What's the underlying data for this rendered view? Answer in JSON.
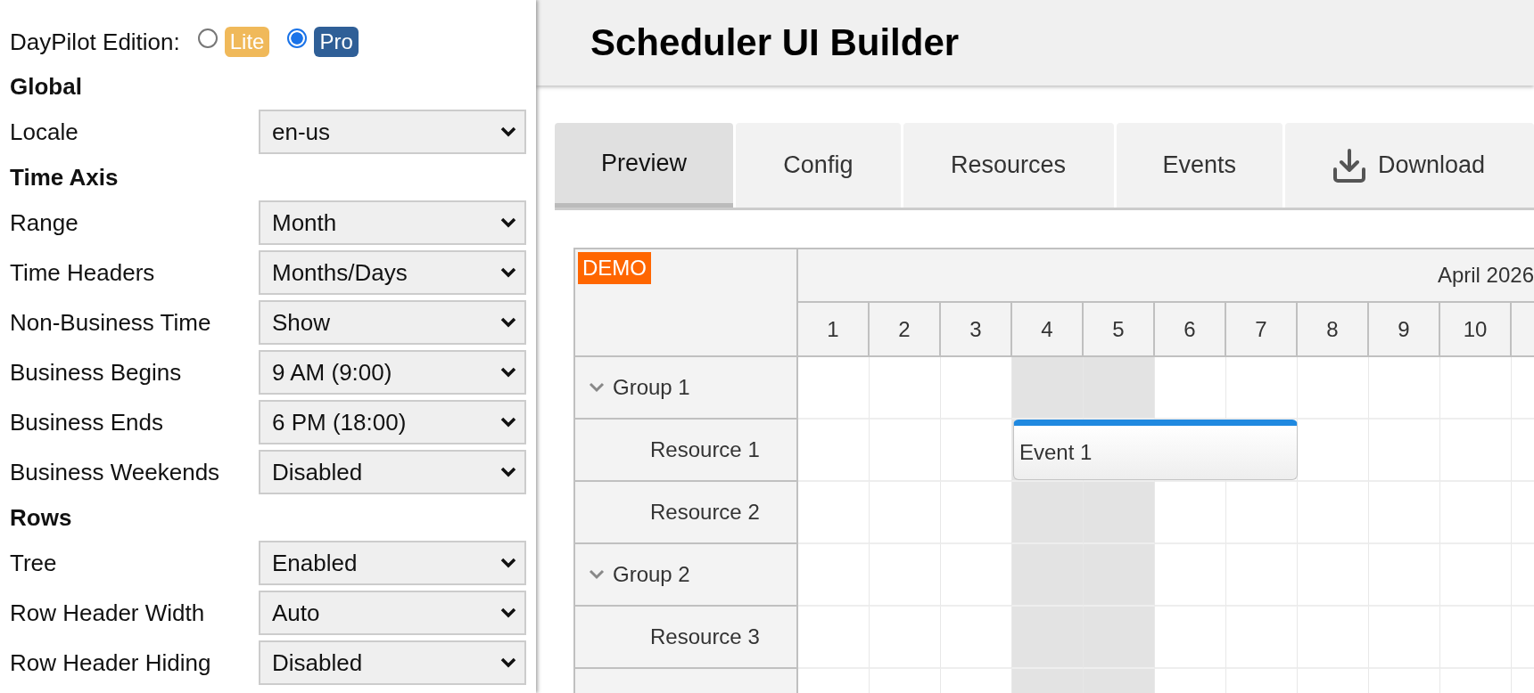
{
  "sidebar": {
    "edition": {
      "label": "DayPilot Edition:",
      "options": [
        {
          "label": "Lite",
          "selected": false,
          "color": "#f0b95a"
        },
        {
          "label": "Pro",
          "selected": true,
          "color": "#2f5f97"
        }
      ]
    },
    "sections": [
      {
        "title": "Global",
        "settings": [
          {
            "label": "Locale",
            "value": "en-us"
          }
        ]
      },
      {
        "title": "Time Axis",
        "settings": [
          {
            "label": "Range",
            "value": "Month"
          },
          {
            "label": "Time Headers",
            "value": "Months/Days"
          },
          {
            "label": "Non-Business Time",
            "value": "Show"
          },
          {
            "label": "Business Begins",
            "value": "9 AM (9:00)"
          },
          {
            "label": "Business Ends",
            "value": "6 PM (18:00)"
          },
          {
            "label": "Business Weekends",
            "value": "Disabled"
          }
        ]
      },
      {
        "title": "Rows",
        "settings": [
          {
            "label": "Tree",
            "value": "Enabled"
          },
          {
            "label": "Row Header Width",
            "value": "Auto"
          },
          {
            "label": "Row Header Hiding",
            "value": "Disabled"
          }
        ]
      }
    ]
  },
  "header": {
    "title": "Scheduler UI Builder"
  },
  "tabs": [
    {
      "label": "Preview",
      "selected": true,
      "kind": "text"
    },
    {
      "label": "Config",
      "selected": false,
      "kind": "text"
    },
    {
      "label": "Resources",
      "selected": false,
      "kind": "text"
    },
    {
      "label": "Events",
      "selected": false,
      "kind": "text"
    },
    {
      "label": "Download",
      "selected": false,
      "kind": "download"
    }
  ],
  "scheduler": {
    "badge": "DEMO",
    "month": "April 2026",
    "days": [
      {
        "label": "1",
        "weekend": false
      },
      {
        "label": "2",
        "weekend": false
      },
      {
        "label": "3",
        "weekend": false
      },
      {
        "label": "4",
        "weekend": true
      },
      {
        "label": "5",
        "weekend": true
      },
      {
        "label": "6",
        "weekend": false
      },
      {
        "label": "7",
        "weekend": false
      },
      {
        "label": "8",
        "weekend": false
      },
      {
        "label": "9",
        "weekend": false
      },
      {
        "label": "10",
        "weekend": false
      }
    ],
    "rows": [
      {
        "name": "Group 1",
        "expanded": true,
        "children": [
          {
            "name": "Resource 1",
            "events": [
              {
                "text": "Event 1"
              }
            ]
          },
          {
            "name": "Resource 2"
          }
        ]
      },
      {
        "name": "Group 2",
        "expanded": true,
        "children": [
          {
            "name": "Resource 3"
          }
        ]
      }
    ]
  }
}
